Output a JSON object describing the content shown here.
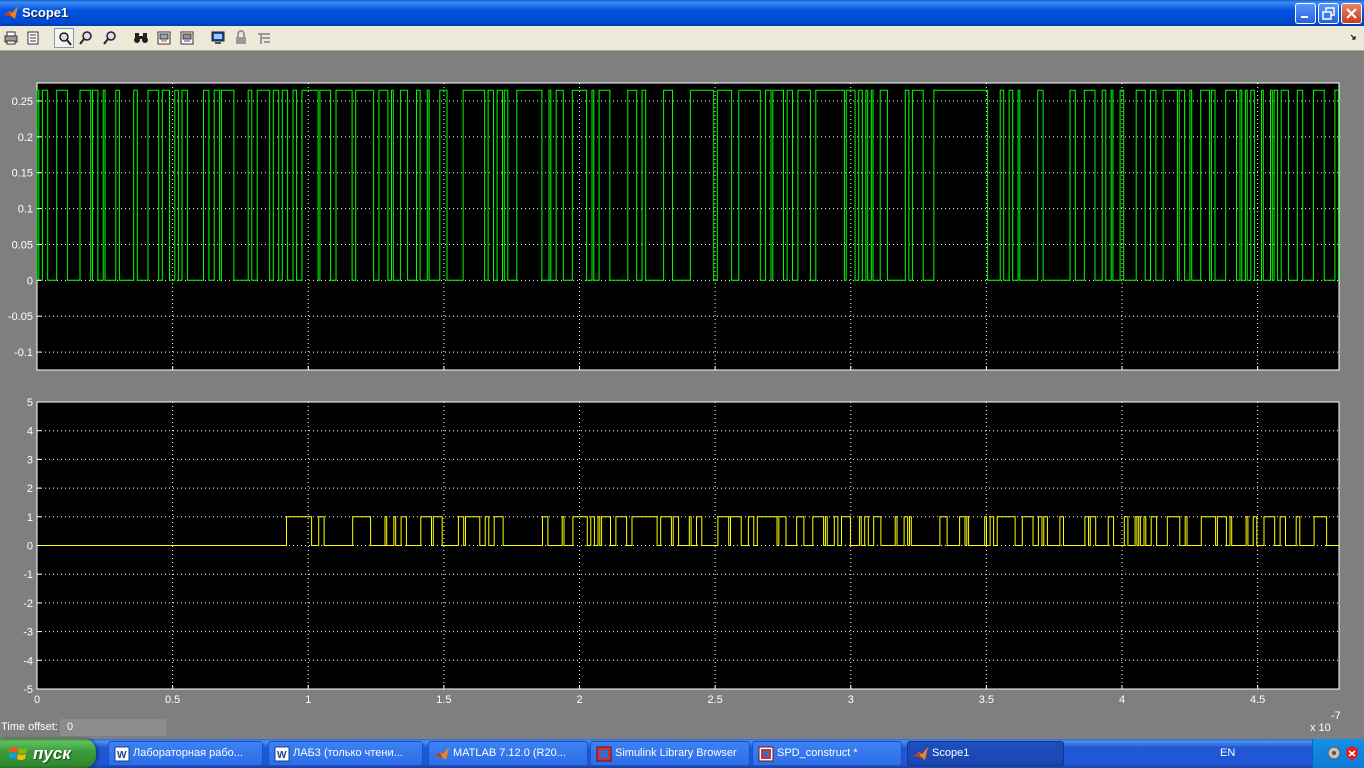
{
  "window": {
    "title": "Scope1"
  },
  "toolbar": {
    "buttons": [
      {
        "icon": "print-icon"
      },
      {
        "icon": "parameters-icon"
      },
      {
        "icon": "zoom-icon"
      },
      {
        "icon": "zoom-x-icon"
      },
      {
        "icon": "zoom-y-icon"
      },
      {
        "icon": "autoscale-icon"
      },
      {
        "icon": "save-axes-icon"
      },
      {
        "icon": "restore-axes-icon"
      },
      {
        "icon": "float-scope-icon"
      },
      {
        "icon": "lock-icon"
      },
      {
        "icon": "signal-selection-icon"
      }
    ]
  },
  "chart_data": [
    {
      "type": "line",
      "xlim": [
        0,
        4.8
      ],
      "ylim": [
        -0.125,
        0.275
      ],
      "x_ticks": [
        "0",
        "0.5",
        "1",
        "1.5",
        "2",
        "2.5",
        "3",
        "3.5",
        "4",
        "4.5"
      ],
      "y_ticks": [
        "0.25",
        "0.2",
        "0.15",
        "0.1",
        "0.05",
        "0",
        "-0.05",
        "-0.1"
      ],
      "y_tick_values": [
        0.25,
        0.2,
        0.15,
        0.1,
        0.05,
        0,
        -0.05,
        -0.1
      ],
      "signal_levels": [
        0,
        0.265
      ],
      "signal_start": 0,
      "grid": true,
      "line_color": "#00ff00",
      "background": "#000000"
    },
    {
      "type": "line",
      "xlim": [
        0,
        4.8
      ],
      "ylim": [
        -5,
        5
      ],
      "x_ticks": [
        "0",
        "0.5",
        "1",
        "1.5",
        "2",
        "2.5",
        "3",
        "3.5",
        "4",
        "4.5"
      ],
      "x_tick_values": [
        0,
        0.5,
        1,
        1.5,
        2,
        2.5,
        3,
        3.5,
        4,
        4.5
      ],
      "y_ticks": [
        "5",
        "4",
        "3",
        "2",
        "1",
        "0",
        "-1",
        "-2",
        "-3",
        "-4",
        "-5"
      ],
      "y_tick_values": [
        5,
        4,
        3,
        2,
        1,
        0,
        -1,
        -2,
        -3,
        -4,
        -5
      ],
      "signal_levels": [
        0,
        1
      ],
      "signal_start": 0.9,
      "grid": true,
      "line_color": "#ffff00",
      "background": "#000000"
    }
  ],
  "x_exponent": {
    "base": "x 10",
    "power": "-7"
  },
  "status": {
    "time_offset_label": "Time offset:",
    "time_offset_value": "0"
  },
  "taskbar": {
    "start_label": "пуск",
    "tasks": [
      {
        "label": "Лабораторная рабо...",
        "icon": "word-icon"
      },
      {
        "label": "ЛАБ3 (только чтени...",
        "icon": "word-icon"
      },
      {
        "label": "MATLAB  7.12.0 (R20...",
        "icon": "matlab-icon"
      },
      {
        "label": "Simulink Library Browser",
        "icon": "simulink-icon"
      },
      {
        "label": "SPD_construct *",
        "icon": "simulink-model-icon"
      },
      {
        "label": "Scope1",
        "icon": "matlab-icon"
      }
    ],
    "language": "EN"
  }
}
